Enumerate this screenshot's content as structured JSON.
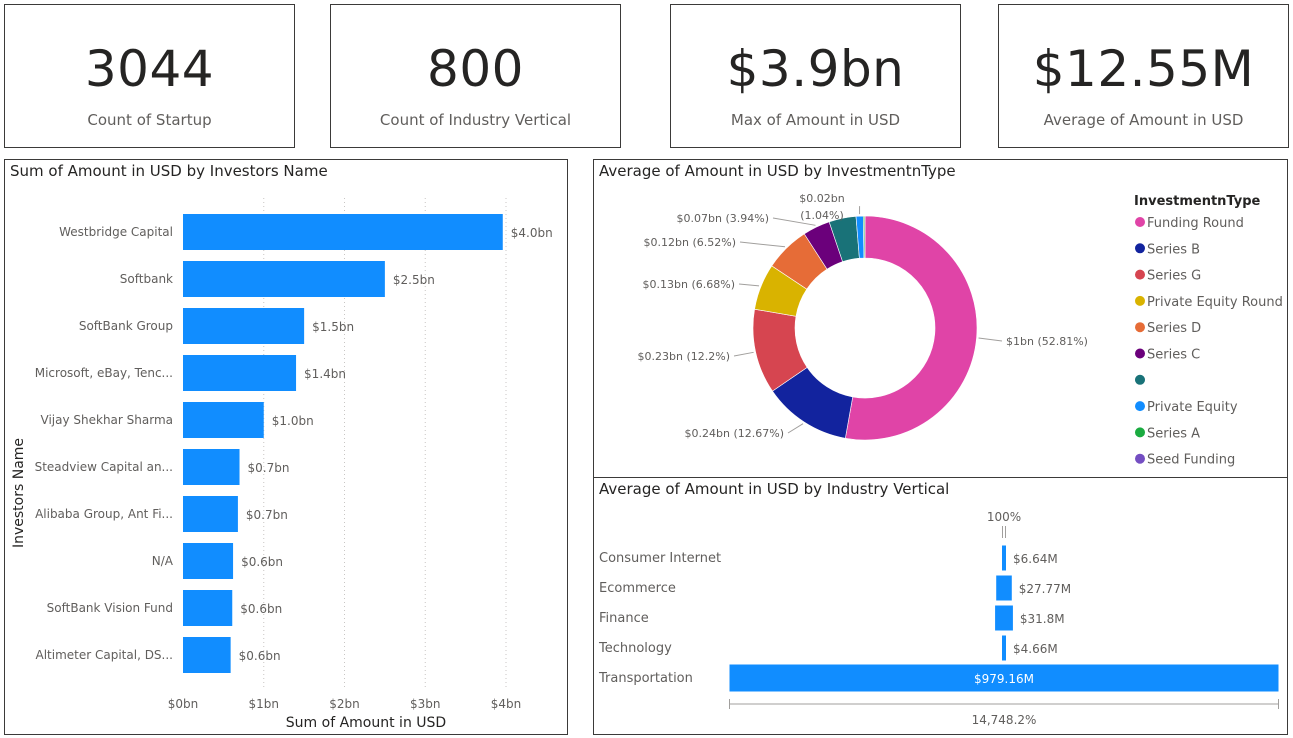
{
  "kpis": [
    {
      "value": "3044",
      "label": "Count of Startup"
    },
    {
      "value": "800",
      "label": "Count of Industry Vertical"
    },
    {
      "value": "$3.9bn",
      "label": "Max of Amount in USD"
    },
    {
      "value": "$12.55M",
      "label": "Average of Amount in USD"
    }
  ],
  "colors": {
    "accent": "#118DFF",
    "funding_round": "#E044A7",
    "series_b": "#12239E",
    "series_g": "#D64550",
    "private_equity_round": "#D9B300",
    "series_d": "#E66C37",
    "series_c": "#6B007B",
    "teal": "#197278",
    "private_equity": "#118DFF",
    "series_a": "#1AAB40",
    "seed_funding": "#744EC2"
  },
  "chart_data": [
    {
      "type": "bar",
      "orientation": "horizontal",
      "title": "Sum of Amount in USD by Investors Name",
      "xlabel": "Sum of Amount in USD",
      "ylabel": "Investors Name",
      "categories": [
        "Westbridge Capital",
        "Softbank",
        "SoftBank Group",
        "Microsoft, eBay, Tenc...",
        "Vijay Shekhar Sharma",
        "Steadview Capital an...",
        "Alibaba Group, Ant Fi...",
        "N/A",
        "SoftBank Vision Fund",
        "Altimeter Capital, DS..."
      ],
      "values": [
        3.96,
        2.5,
        1.5,
        1.4,
        1.0,
        0.7,
        0.68,
        0.62,
        0.61,
        0.59
      ],
      "value_labels": [
        "$4.0bn",
        "$2.5bn",
        "$1.5bn",
        "$1.4bn",
        "$1.0bn",
        "$0.7bn",
        "$0.7bn",
        "$0.6bn",
        "$0.6bn",
        "$0.6bn"
      ],
      "x_ticks": [
        "$0bn",
        "$1bn",
        "$2bn",
        "$3bn",
        "$4bn"
      ],
      "xlim": [
        0,
        4.4
      ],
      "grid": true
    },
    {
      "type": "pie",
      "donut": true,
      "title": "Average of Amount in USD by InvestmentnType",
      "legend_title": "InvestmentnType",
      "legend_position": "right",
      "legend": [
        "Funding Round",
        "Series B",
        "Series G",
        "Private Equity Round",
        "Series D",
        "Series C",
        "",
        "Private Equity",
        "Series A",
        "Seed Funding"
      ],
      "slices": [
        {
          "name": "Funding Round",
          "value": 1.0,
          "percent": 52.81,
          "label": "$1bn (52.81%)"
        },
        {
          "name": "Series B",
          "value": 0.24,
          "percent": 12.67,
          "label": "$0.24bn (12.67%)"
        },
        {
          "name": "Series G",
          "value": 0.23,
          "percent": 12.2,
          "label": "$0.23bn (12.2%)"
        },
        {
          "name": "Private Equity Round",
          "value": 0.13,
          "percent": 6.68,
          "label": "$0.13bn (6.68%)"
        },
        {
          "name": "Series D",
          "value": 0.12,
          "percent": 6.52,
          "label": "$0.12bn (6.52%)"
        },
        {
          "name": "Series C",
          "value": 0.07,
          "percent": 3.94,
          "label": "$0.07bn (3.94%)"
        },
        {
          "name": "",
          "value": 0.07,
          "percent": 3.9,
          "label": ""
        },
        {
          "name": "Private Equity",
          "value": 0.02,
          "percent": 1.04,
          "label": "$0.02bn (1.04%)"
        },
        {
          "name": "Series A",
          "value": 0.004,
          "percent": 0.2,
          "label": ""
        },
        {
          "name": "Seed Funding",
          "value": 0.001,
          "percent": 0.04,
          "label": ""
        }
      ],
      "label_texts": [
        "$0.02bn",
        "(1.04%)"
      ]
    },
    {
      "type": "bar",
      "orientation": "horizontal",
      "variant": "funnel",
      "title": "Average of Amount in USD by Industry Vertical",
      "categories": [
        "Consumer Internet",
        "Ecommerce",
        "Finance",
        "Technology",
        "Transportation"
      ],
      "values": [
        6.64,
        27.77,
        31.8,
        4.66,
        979.16
      ],
      "value_labels": [
        "$6.64M",
        "$27.77M",
        "$31.8M",
        "$4.66M",
        "$979.16M"
      ],
      "top_percent": "100%",
      "bottom_percent": "14,748.2%"
    }
  ]
}
